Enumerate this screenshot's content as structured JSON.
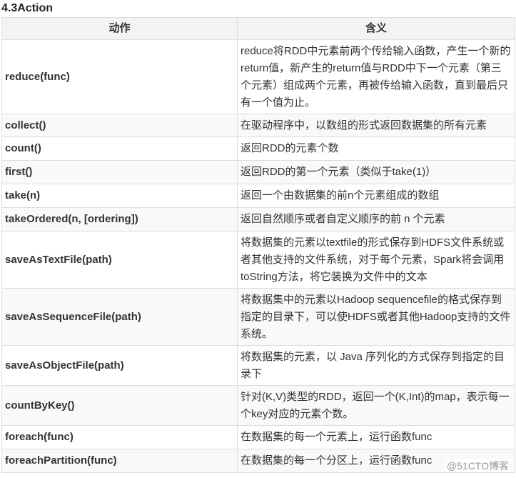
{
  "heading": "4.3Action",
  "table": {
    "headers": [
      "动作",
      "含义"
    ],
    "rows": [
      {
        "action": "reduce(func)",
        "meaning": "reduce将RDD中元素前两个传给输入函数，产生一个新的return值，新产生的return值与RDD中下一个元素（第三个元素）组成两个元素，再被传给输入函数，直到最后只有一个值为止。"
      },
      {
        "action": "collect()",
        "meaning": "在驱动程序中，以数组的形式返回数据集的所有元素"
      },
      {
        "action": "count()",
        "meaning": "返回RDD的元素个数"
      },
      {
        "action": "first()",
        "meaning": "返回RDD的第一个元素（类似于take(1)）"
      },
      {
        "action": "take(n)",
        "meaning": "返回一个由数据集的前n个元素组成的数组"
      },
      {
        "action": "takeOrdered(n, [ordering])",
        "meaning": "返回自然顺序或者自定义顺序的前 n 个元素"
      },
      {
        "action": "saveAsTextFile(path)",
        "meaning": "将数据集的元素以textfile的形式保存到HDFS文件系统或者其他支持的文件系统，对于每个元素，Spark将会调用toString方法，将它装换为文件中的文本"
      },
      {
        "action": "saveAsSequenceFile(path)",
        "meaning": "将数据集中的元素以Hadoop sequencefile的格式保存到指定的目录下，可以使HDFS或者其他Hadoop支持的文件系统。"
      },
      {
        "action": "saveAsObjectFile(path)",
        "meaning": "将数据集的元素，以 Java 序列化的方式保存到指定的目录下"
      },
      {
        "action": "countByKey()",
        "meaning": "针对(K,V)类型的RDD，返回一个(K,Int)的map，表示每一个key对应的元素个数。"
      },
      {
        "action": "foreach(func)",
        "meaning": "在数据集的每一个元素上，运行函数func"
      },
      {
        "action": "foreachPartition(func)",
        "meaning": "在数据集的每一个分区上，运行函数func"
      }
    ]
  },
  "watermark": "@51CTO博客"
}
